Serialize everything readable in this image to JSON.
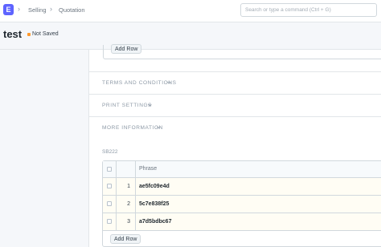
{
  "navbar": {
    "logo": "E",
    "breadcrumbs": [
      "Selling",
      "Quotation"
    ],
    "search_placeholder": "Search or type a command (Ctrl + G)"
  },
  "page": {
    "title": "test",
    "status": "Not Saved",
    "status_color": "#ff9a2e"
  },
  "main": {
    "prev_add_row_label": "Add Row",
    "sections": [
      {
        "label": "TERMS AND CONDITIONS"
      },
      {
        "label": "PRINT SETTINGS"
      },
      {
        "label": "MORE INFORMATION"
      }
    ],
    "table_field_label": "SB222",
    "table": {
      "header": "Phrase",
      "rows": [
        {
          "idx": "1",
          "phrase": "ae5fc09e4d"
        },
        {
          "idx": "2",
          "phrase": "5c7e838f25"
        },
        {
          "idx": "3",
          "phrase": "a7d5bdbc67"
        }
      ],
      "add_row_label": "Add Row"
    }
  }
}
